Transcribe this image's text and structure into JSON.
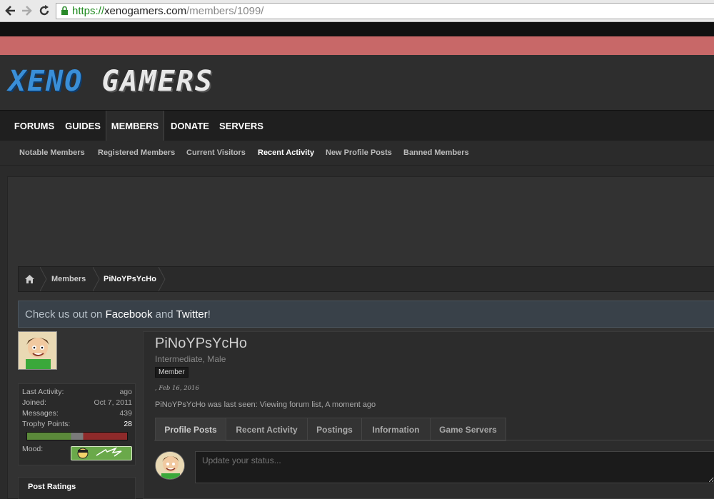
{
  "browser": {
    "url_scheme": "https://",
    "url_host": "xenogamers.com",
    "url_path": "/members/1099/"
  },
  "site": {
    "logo_xeno": "XENO",
    "logo_gamers": "GAMERS"
  },
  "main_nav": {
    "tabs": [
      {
        "label": "FORUMS"
      },
      {
        "label": "GUIDES"
      },
      {
        "label": "MEMBERS"
      },
      {
        "label": "DONATE"
      },
      {
        "label": "SERVERS"
      }
    ]
  },
  "sub_nav": {
    "items": [
      {
        "label": "Notable Members"
      },
      {
        "label": "Registered Members"
      },
      {
        "label": "Current Visitors"
      },
      {
        "label": "Recent Activity"
      },
      {
        "label": "New Profile Posts"
      },
      {
        "label": "Banned Members"
      }
    ]
  },
  "breadcrumb": {
    "items": [
      {
        "label": "Members"
      },
      {
        "label": "PiNoYPsYcHo"
      }
    ]
  },
  "notice": {
    "prefix": "Check us out on ",
    "facebook": "Facebook",
    "and": " and ",
    "twitter": "Twitter",
    "suffix": "!"
  },
  "sidebar": {
    "stats": [
      {
        "label": "Last Activity:",
        "value": "ago"
      },
      {
        "label": "Joined:",
        "value": "Oct 7, 2011"
      },
      {
        "label": "Messages:",
        "value": "439"
      },
      {
        "label": "Trophy Points:",
        "value": "28"
      }
    ],
    "mood_label": "Mood:",
    "post_ratings": "Post Ratings"
  },
  "profile": {
    "username": "PiNoYPsYcHo",
    "user_title": "Intermediate, Male",
    "badge": "Member",
    "date": ", Feb 16, 2016",
    "last_seen_prefix": "PiNoYPsYcHo was last seen: ",
    "last_seen_link": "Viewing forum list",
    "last_seen_suffix": ", A moment ago",
    "tabs": [
      {
        "label": "Profile Posts"
      },
      {
        "label": "Recent Activity"
      },
      {
        "label": "Postings"
      },
      {
        "label": "Information"
      },
      {
        "label": "Game Servers"
      }
    ],
    "status_placeholder": "Update your status..."
  },
  "colors": {
    "accent_red": "#c86868",
    "logo_blue": "#3a8fd8"
  }
}
